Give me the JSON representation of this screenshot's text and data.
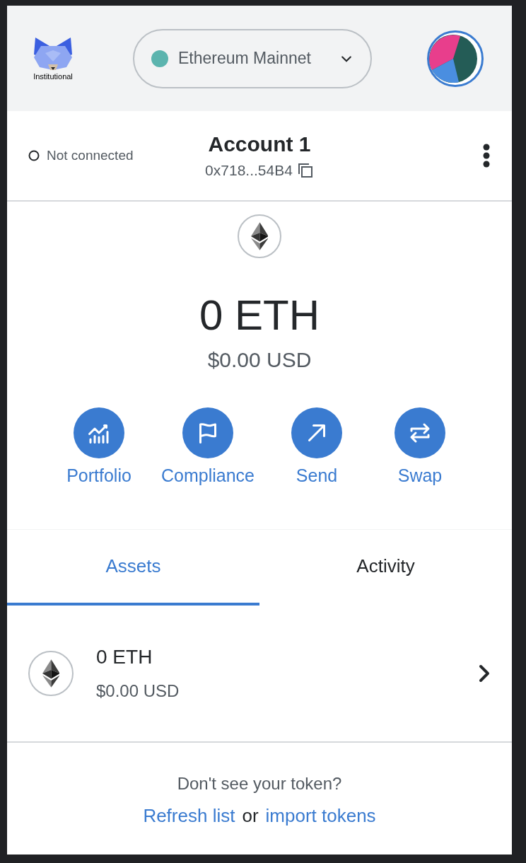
{
  "header": {
    "logo_caption": "Institutional",
    "network": "Ethereum Mainnet"
  },
  "account": {
    "connection": "Not connected",
    "name": "Account 1",
    "address": "0x718...54B4"
  },
  "balance": {
    "amount": "0 ETH",
    "fiat": "$0.00 USD"
  },
  "actions": [
    {
      "label": "Portfolio",
      "kind": "chart"
    },
    {
      "label": "Compliance",
      "kind": "flag"
    },
    {
      "label": "Send",
      "kind": "arrow"
    },
    {
      "label": "Swap",
      "kind": "swap"
    }
  ],
  "tabs": [
    {
      "label": "Assets",
      "selected": true
    },
    {
      "label": "Activity",
      "selected": false
    }
  ],
  "assets": [
    {
      "amount": "0 ETH",
      "fiat": "$0.00 USD"
    }
  ],
  "footer": {
    "question": "Don't see your token?",
    "refresh_link": "Refresh list",
    "joiner": "or",
    "import_link": "import tokens"
  }
}
